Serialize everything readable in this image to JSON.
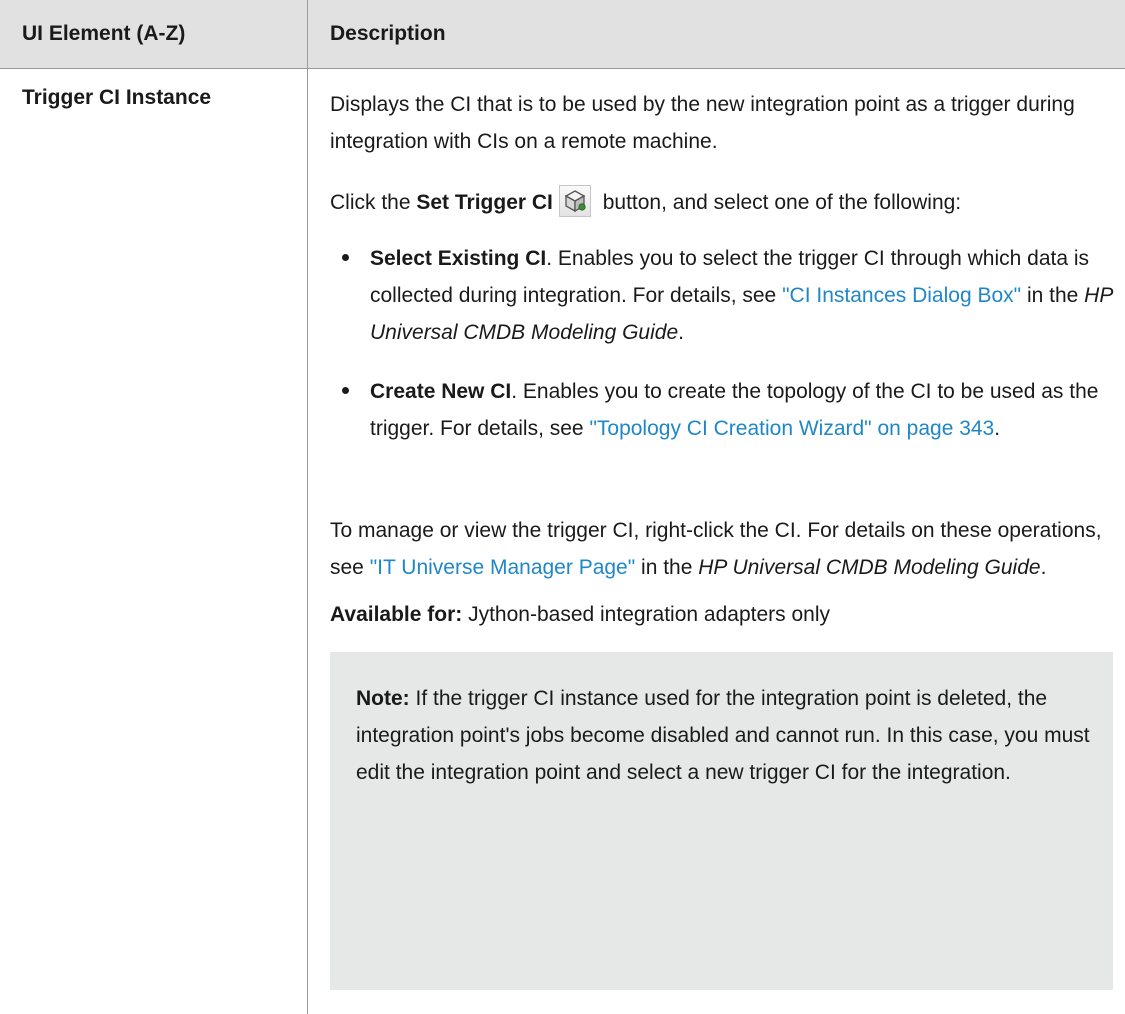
{
  "table": {
    "headers": [
      "UI Element (A-Z)",
      "Description"
    ],
    "row": {
      "element_name": "Trigger CI Instance",
      "p1": "Displays the CI that is to be used by the new integration point as a trigger during integration with CIs on a remote machine.",
      "p2_a": "Click the ",
      "p2_bold": "Set Trigger CI",
      "p2_b": " button, and select one of the following:",
      "button_icon": "cube-trigger-icon",
      "bullets": [
        {
          "bold": "Select Existing CI",
          "text": ". Enables you to select the trigger CI through which data is collected during integration. For details, see ",
          "link": "\"CI Instances Dialog Box\"",
          "after": " in the ",
          "italic": "HP Universal CMDB Modeling Guide",
          "end": "."
        },
        {
          "bold": "Create New CI",
          "text": ". Enables you to create the topology of the CI to be used as the trigger. For details, see ",
          "link": "\"Topology CI Creation Wizard\" on page 343",
          "end": "."
        }
      ],
      "p3_a": "To manage or view the trigger CI, right-click the CI. For details on these operations, see ",
      "p3_link": "\"IT Universe Manager Page\"",
      "p3_b": " in the ",
      "p3_italic": "HP Universal CMDB Modeling Guide",
      "p3_end": ".",
      "p4_bold": "Available for:",
      "p4_text": " Jython-based integration adapters only",
      "note_bold": "Note:",
      "note_text": " If the trigger CI instance used for the integration point is deleted, the integration point's jobs become disabled and cannot run. In this case, you must edit the integration point and select a new trigger CI for the integration."
    }
  },
  "colors": {
    "header_bg": "#e1e1e1",
    "link": "#1f87c8",
    "note_bg": "#e6e7e7",
    "rule": "#9a9a9a"
  }
}
